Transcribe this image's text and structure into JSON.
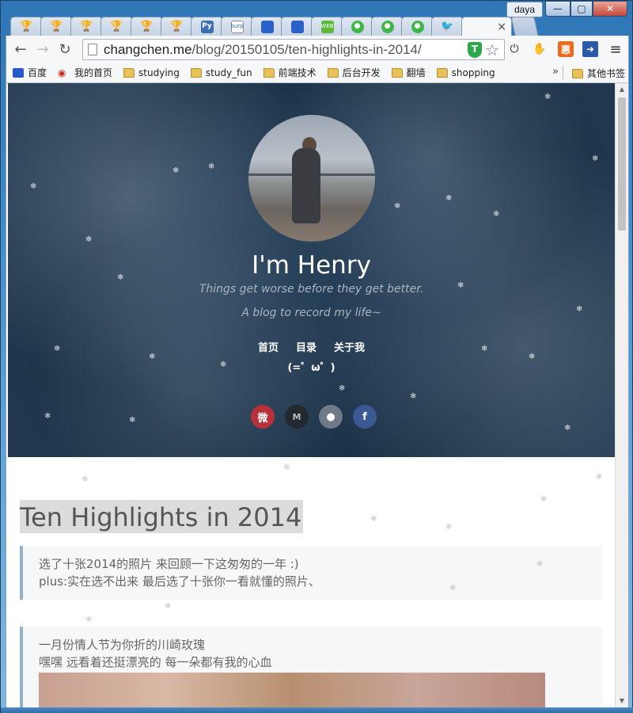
{
  "window": {
    "user": "daya",
    "controls": {
      "minimize": "—",
      "maximize": "▢",
      "close": "✕"
    }
  },
  "tabs": {
    "items": [
      {
        "icon": "trophy"
      },
      {
        "icon": "trophy"
      },
      {
        "icon": "trophy"
      },
      {
        "icon": "trophy"
      },
      {
        "icon": "trophy"
      },
      {
        "icon": "trophy"
      },
      {
        "icon": "python",
        "label": "Py"
      },
      {
        "icon": "burp",
        "label": "burp"
      },
      {
        "icon": "baidu-paw"
      },
      {
        "icon": "baidu-paw"
      },
      {
        "icon": "web",
        "label": "WEB"
      },
      {
        "icon": "wechat"
      },
      {
        "icon": "wechat"
      },
      {
        "icon": "wechat"
      },
      {
        "icon": "bird"
      }
    ],
    "active_close": "×"
  },
  "toolbar": {
    "back": "←",
    "forward": "→",
    "reload": "↻",
    "url_host": "changchen.me",
    "url_path": "/blog/20150105/ten-highlights-in-2014/",
    "shield_label": "T",
    "star": "☆",
    "extensions": {
      "power": "⏻",
      "hand": "✋",
      "gong": "惠",
      "forward": "➜",
      "menu": "≡"
    }
  },
  "bookmarks": {
    "items": [
      {
        "label": "百度",
        "icon": "baidu"
      },
      {
        "label": "我的首页",
        "icon": "weibo"
      },
      {
        "label": "studying",
        "icon": "folder"
      },
      {
        "label": "study_fun",
        "icon": "folder"
      },
      {
        "label": "前端技术",
        "icon": "folder"
      },
      {
        "label": "后台开发",
        "icon": "folder"
      },
      {
        "label": "翻墙",
        "icon": "folder"
      },
      {
        "label": "shopping",
        "icon": "folder"
      }
    ],
    "more": "»",
    "other": "其他书签"
  },
  "hero": {
    "title": "I'm Henry",
    "subtitle1": "Things get worse before they get better.",
    "subtitle2": "A blog to record my life~",
    "nav": [
      "首页",
      "目录",
      "关于我"
    ],
    "emoticon": "(=゜ω゜)",
    "social": {
      "weibo": "微",
      "mail": "M",
      "github": "●",
      "facebook": "f"
    }
  },
  "article": {
    "title": "Ten Highlights in 2014",
    "intro_line1": "选了十张2014的照片 来回顾一下这匆匆的一年 :)",
    "intro_line2": "plus:实在选不出来 最后选了十张你一看就懂的照片、",
    "item1_line1": "一月份情人节为你折的川崎玫瑰",
    "item1_line2": "嘿嘿 远看着还挺漂亮的 每一朵都有我的心血"
  },
  "scrollbar": {
    "up": "▲",
    "down": "▼",
    "position": 0
  },
  "colors": {
    "hero_bg": "#1a3045",
    "quote_border": "#8fb2d0",
    "weibo": "#b7313a",
    "facebook": "#3b5a94",
    "shield": "#2aa84a"
  }
}
